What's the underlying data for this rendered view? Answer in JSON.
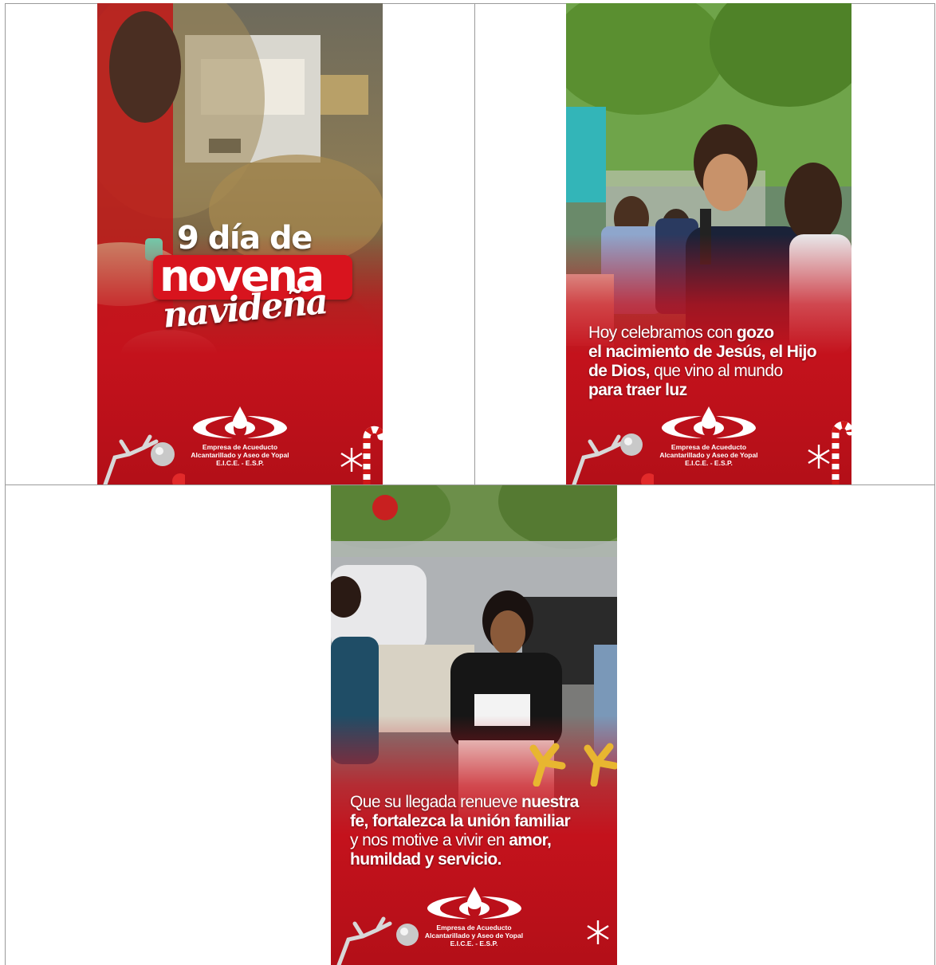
{
  "panels": [
    {
      "title": {
        "line1": "9 día de",
        "line2": "novena",
        "line3": "navideña"
      }
    },
    {
      "caption": {
        "l1a": "Hoy celebramos con ",
        "l1b": "gozo",
        "l2": "el nacimiento de Jesús, el Hijo",
        "l3a": "de Dios,",
        "l3b": " que vino al mundo",
        "l4": "para traer luz"
      }
    },
    {
      "caption": {
        "l1a": "Que su llegada renueve ",
        "l1b": "nuestra",
        "l2": "fe, fortalezca la unión familiar",
        "l3a": "y nos motive a vivir en ",
        "l3b": "amor,",
        "l4": "humildad y servicio."
      }
    }
  ],
  "logo": {
    "line1": "Empresa de Acueducto",
    "line2": "Alcantarillado y Aseo de Yopal",
    "line3": "E.I.C.E. - E.S.P."
  },
  "colors": {
    "brand_red": "#c4121c",
    "white": "#ffffff"
  }
}
